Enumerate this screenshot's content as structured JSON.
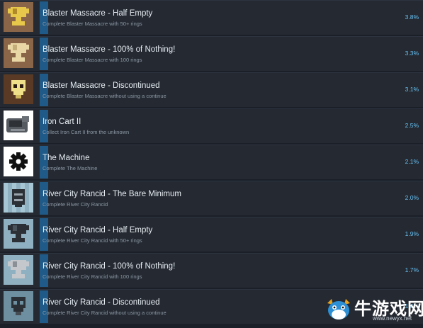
{
  "achievements": [
    {
      "title": "Blaster Massacre - Half Empty",
      "desc": "Complete Blaster Massacre with 50+ rings",
      "percent": "3.8%",
      "icon": "gold-trophy-icon",
      "colors": {
        "bg": "#8a6548",
        "art": "#e8c84a"
      }
    },
    {
      "title": "Blaster Massacre - 100% of Nothing!",
      "desc": "Complete Blaster Massacre with 100 rings",
      "percent": "3.3%",
      "icon": "tan-trophy-icon",
      "colors": {
        "bg": "#8a6548",
        "art": "#e9d8a6"
      }
    },
    {
      "title": "Blaster Massacre - Discontinued",
      "desc": "Complete Blaster Massacre without using a continue",
      "percent": "3.1%",
      "icon": "skull-icon",
      "colors": {
        "bg": "#5a3a24",
        "art": "#f0e08a"
      }
    },
    {
      "title": "Iron Cart II",
      "desc": "Collect Iron Cart II from the unknown",
      "percent": "2.5%",
      "icon": "iron-cart-icon",
      "colors": {
        "bg": "#ffffff",
        "art": "#555a60"
      }
    },
    {
      "title": "The Machine",
      "desc": "Complete The Machine",
      "percent": "2.1%",
      "icon": "gear-icon",
      "colors": {
        "bg": "#ffffff",
        "art": "#111111"
      }
    },
    {
      "title": "River City Rancid - The Bare Minimum",
      "desc": "Complete River City Rancid",
      "percent": "2.0%",
      "icon": "robot-head-icon",
      "colors": {
        "bg": "#a6c6d6",
        "art": "#2b3036"
      }
    },
    {
      "title": "River City Rancid - Half Empty",
      "desc": "Complete River City Rancid with 50+ rings",
      "percent": "1.9%",
      "icon": "dark-trophy-icon",
      "colors": {
        "bg": "#8fb0c0",
        "art": "#2b3036"
      }
    },
    {
      "title": "River City Rancid - 100% of Nothing!",
      "desc": "Complete River City Rancid with 100 rings",
      "percent": "1.7%",
      "icon": "silver-trophy-icon",
      "colors": {
        "bg": "#8fb0c0",
        "art": "#c4c8cc"
      }
    },
    {
      "title": "River City Rancid - Discontinued",
      "desc": "Complete River City Rancid without using a continue",
      "percent": "1.6%",
      "icon": "dark-skull-icon",
      "colors": {
        "bg": "#6d8fa0",
        "art": "#2b3036"
      }
    }
  ],
  "watermark": {
    "text": "牛游戏网",
    "url": "www.newyx.net",
    "icon": "cow-mascot-icon"
  }
}
